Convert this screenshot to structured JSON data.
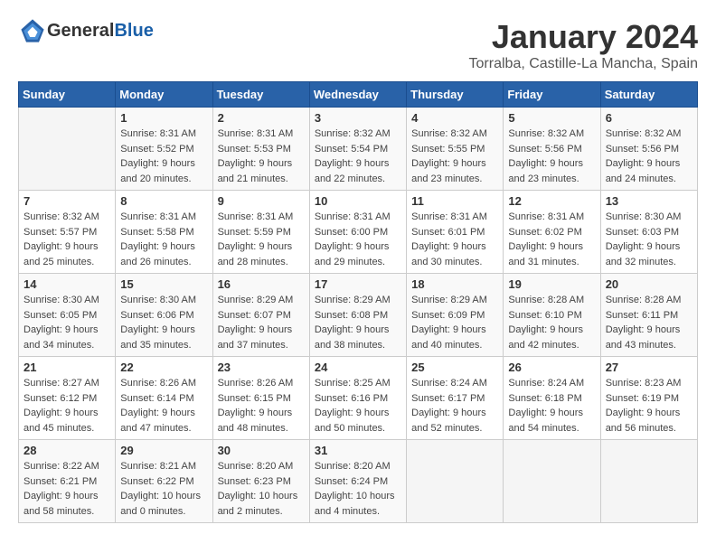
{
  "header": {
    "logo_general": "General",
    "logo_blue": "Blue",
    "month": "January 2024",
    "location": "Torralba, Castille-La Mancha, Spain"
  },
  "weekdays": [
    "Sunday",
    "Monday",
    "Tuesday",
    "Wednesday",
    "Thursday",
    "Friday",
    "Saturday"
  ],
  "weeks": [
    [
      {
        "day": "",
        "info": ""
      },
      {
        "day": "1",
        "info": "Sunrise: 8:31 AM\nSunset: 5:52 PM\nDaylight: 9 hours\nand 20 minutes."
      },
      {
        "day": "2",
        "info": "Sunrise: 8:31 AM\nSunset: 5:53 PM\nDaylight: 9 hours\nand 21 minutes."
      },
      {
        "day": "3",
        "info": "Sunrise: 8:32 AM\nSunset: 5:54 PM\nDaylight: 9 hours\nand 22 minutes."
      },
      {
        "day": "4",
        "info": "Sunrise: 8:32 AM\nSunset: 5:55 PM\nDaylight: 9 hours\nand 23 minutes."
      },
      {
        "day": "5",
        "info": "Sunrise: 8:32 AM\nSunset: 5:56 PM\nDaylight: 9 hours\nand 23 minutes."
      },
      {
        "day": "6",
        "info": "Sunrise: 8:32 AM\nSunset: 5:56 PM\nDaylight: 9 hours\nand 24 minutes."
      }
    ],
    [
      {
        "day": "7",
        "info": "Sunrise: 8:32 AM\nSunset: 5:57 PM\nDaylight: 9 hours\nand 25 minutes."
      },
      {
        "day": "8",
        "info": "Sunrise: 8:31 AM\nSunset: 5:58 PM\nDaylight: 9 hours\nand 26 minutes."
      },
      {
        "day": "9",
        "info": "Sunrise: 8:31 AM\nSunset: 5:59 PM\nDaylight: 9 hours\nand 28 minutes."
      },
      {
        "day": "10",
        "info": "Sunrise: 8:31 AM\nSunset: 6:00 PM\nDaylight: 9 hours\nand 29 minutes."
      },
      {
        "day": "11",
        "info": "Sunrise: 8:31 AM\nSunset: 6:01 PM\nDaylight: 9 hours\nand 30 minutes."
      },
      {
        "day": "12",
        "info": "Sunrise: 8:31 AM\nSunset: 6:02 PM\nDaylight: 9 hours\nand 31 minutes."
      },
      {
        "day": "13",
        "info": "Sunrise: 8:30 AM\nSunset: 6:03 PM\nDaylight: 9 hours\nand 32 minutes."
      }
    ],
    [
      {
        "day": "14",
        "info": "Sunrise: 8:30 AM\nSunset: 6:05 PM\nDaylight: 9 hours\nand 34 minutes."
      },
      {
        "day": "15",
        "info": "Sunrise: 8:30 AM\nSunset: 6:06 PM\nDaylight: 9 hours\nand 35 minutes."
      },
      {
        "day": "16",
        "info": "Sunrise: 8:29 AM\nSunset: 6:07 PM\nDaylight: 9 hours\nand 37 minutes."
      },
      {
        "day": "17",
        "info": "Sunrise: 8:29 AM\nSunset: 6:08 PM\nDaylight: 9 hours\nand 38 minutes."
      },
      {
        "day": "18",
        "info": "Sunrise: 8:29 AM\nSunset: 6:09 PM\nDaylight: 9 hours\nand 40 minutes."
      },
      {
        "day": "19",
        "info": "Sunrise: 8:28 AM\nSunset: 6:10 PM\nDaylight: 9 hours\nand 42 minutes."
      },
      {
        "day": "20",
        "info": "Sunrise: 8:28 AM\nSunset: 6:11 PM\nDaylight: 9 hours\nand 43 minutes."
      }
    ],
    [
      {
        "day": "21",
        "info": "Sunrise: 8:27 AM\nSunset: 6:12 PM\nDaylight: 9 hours\nand 45 minutes."
      },
      {
        "day": "22",
        "info": "Sunrise: 8:26 AM\nSunset: 6:14 PM\nDaylight: 9 hours\nand 47 minutes."
      },
      {
        "day": "23",
        "info": "Sunrise: 8:26 AM\nSunset: 6:15 PM\nDaylight: 9 hours\nand 48 minutes."
      },
      {
        "day": "24",
        "info": "Sunrise: 8:25 AM\nSunset: 6:16 PM\nDaylight: 9 hours\nand 50 minutes."
      },
      {
        "day": "25",
        "info": "Sunrise: 8:24 AM\nSunset: 6:17 PM\nDaylight: 9 hours\nand 52 minutes."
      },
      {
        "day": "26",
        "info": "Sunrise: 8:24 AM\nSunset: 6:18 PM\nDaylight: 9 hours\nand 54 minutes."
      },
      {
        "day": "27",
        "info": "Sunrise: 8:23 AM\nSunset: 6:19 PM\nDaylight: 9 hours\nand 56 minutes."
      }
    ],
    [
      {
        "day": "28",
        "info": "Sunrise: 8:22 AM\nSunset: 6:21 PM\nDaylight: 9 hours\nand 58 minutes."
      },
      {
        "day": "29",
        "info": "Sunrise: 8:21 AM\nSunset: 6:22 PM\nDaylight: 10 hours\nand 0 minutes."
      },
      {
        "day": "30",
        "info": "Sunrise: 8:20 AM\nSunset: 6:23 PM\nDaylight: 10 hours\nand 2 minutes."
      },
      {
        "day": "31",
        "info": "Sunrise: 8:20 AM\nSunset: 6:24 PM\nDaylight: 10 hours\nand 4 minutes."
      },
      {
        "day": "",
        "info": ""
      },
      {
        "day": "",
        "info": ""
      },
      {
        "day": "",
        "info": ""
      }
    ]
  ]
}
